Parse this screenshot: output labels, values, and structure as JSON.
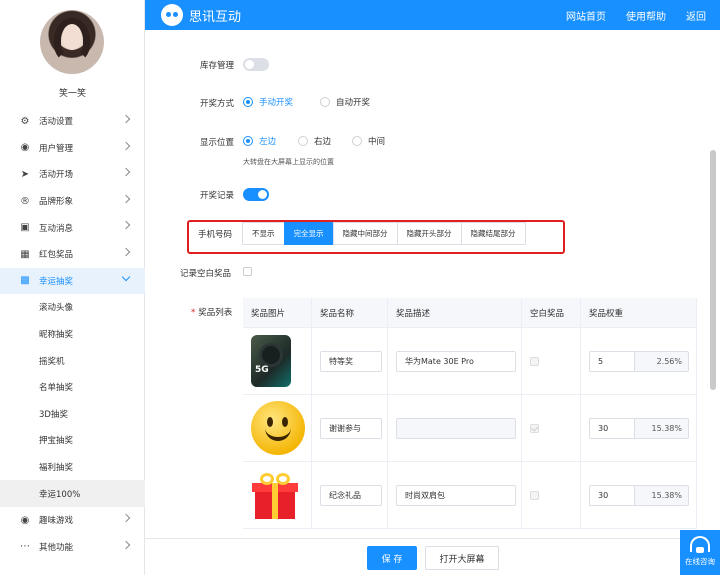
{
  "app": {
    "brand": "思讯互动",
    "nav": [
      "网站首页",
      "使用帮助",
      "返回"
    ]
  },
  "user": {
    "name": "笑一笑"
  },
  "sidebar": {
    "items": [
      {
        "label": "活动设置",
        "icon": "gear-icon"
      },
      {
        "label": "用户管理",
        "icon": "user-icon"
      },
      {
        "label": "活动开场",
        "icon": "send-icon"
      },
      {
        "label": "品牌形象",
        "icon": "brand-r-icon"
      },
      {
        "label": "互动消息",
        "icon": "message-icon"
      },
      {
        "label": "红包奖品",
        "icon": "red-packet-icon"
      },
      {
        "label": "幸运抽奖",
        "icon": "lottery-icon"
      }
    ],
    "subitems": [
      "滚动头像",
      "昵称抽奖",
      "摇奖机",
      "名单抽奖",
      "3D抽奖",
      "押宝抽奖",
      "福利抽奖",
      "幸运100%"
    ],
    "bottom_items": [
      {
        "label": "趣味游戏",
        "icon": "game-icon"
      },
      {
        "label": "其他功能",
        "icon": "more-icon"
      }
    ]
  },
  "form": {
    "stock_label": "库存管理",
    "draw_mode_label": "开奖方式",
    "draw_mode_options": [
      "手动开奖",
      "自动开奖"
    ],
    "position_label": "显示位置",
    "position_options": [
      "左边",
      "右边",
      "中间"
    ],
    "position_hint": "大转盘在大屏幕上显示的位置",
    "record_label": "开奖记录",
    "phone_label": "手机号码",
    "phone_options": [
      "不显示",
      "完全显示",
      "隐藏中间部分",
      "隐藏开头部分",
      "隐藏结尾部分"
    ],
    "blank_label": "记录空白奖品",
    "prize_list_label": "奖品列表"
  },
  "table": {
    "headers": [
      "奖品图片",
      "奖品名称",
      "奖品描述",
      "空白奖品",
      "奖品权重"
    ],
    "rows": [
      {
        "image": "phone-image",
        "name": "特等奖",
        "desc": "华为Mate 30E Pro",
        "weight": "5",
        "percent": "2.56%"
      },
      {
        "image": "smiley-image",
        "name": "谢谢参与",
        "desc": "",
        "weight": "30",
        "percent": "15.38%"
      },
      {
        "image": "gift-image",
        "name": "纪念礼品",
        "desc": "时尚双肩包",
        "weight": "30",
        "percent": "15.38%"
      }
    ]
  },
  "footer": {
    "save": "保 存",
    "open_screen": "打开大屏幕"
  },
  "support": {
    "label": "在线咨询"
  },
  "colors": {
    "accent": "#1890ff",
    "highlight": "#e02020"
  }
}
